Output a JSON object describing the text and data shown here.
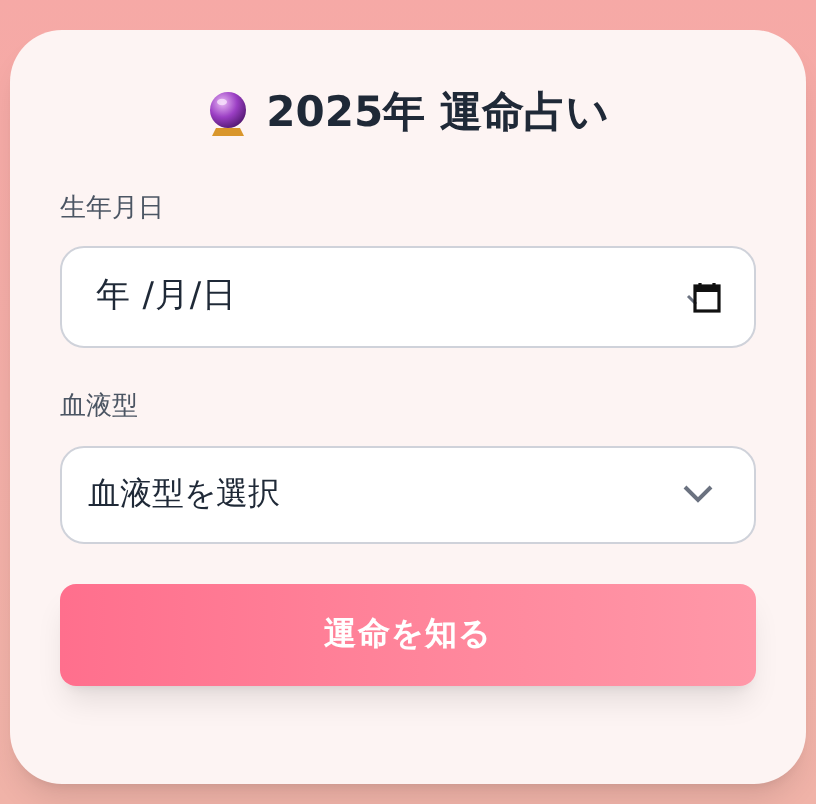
{
  "title": "2025年 運命占い",
  "fields": [
    {
      "kind": "date",
      "label": "生年月日",
      "placeholder": "年 /月/日"
    },
    {
      "kind": "select",
      "label": "血液型",
      "placeholder": "血液型を選択"
    }
  ],
  "submit_button": "運命を知る"
}
